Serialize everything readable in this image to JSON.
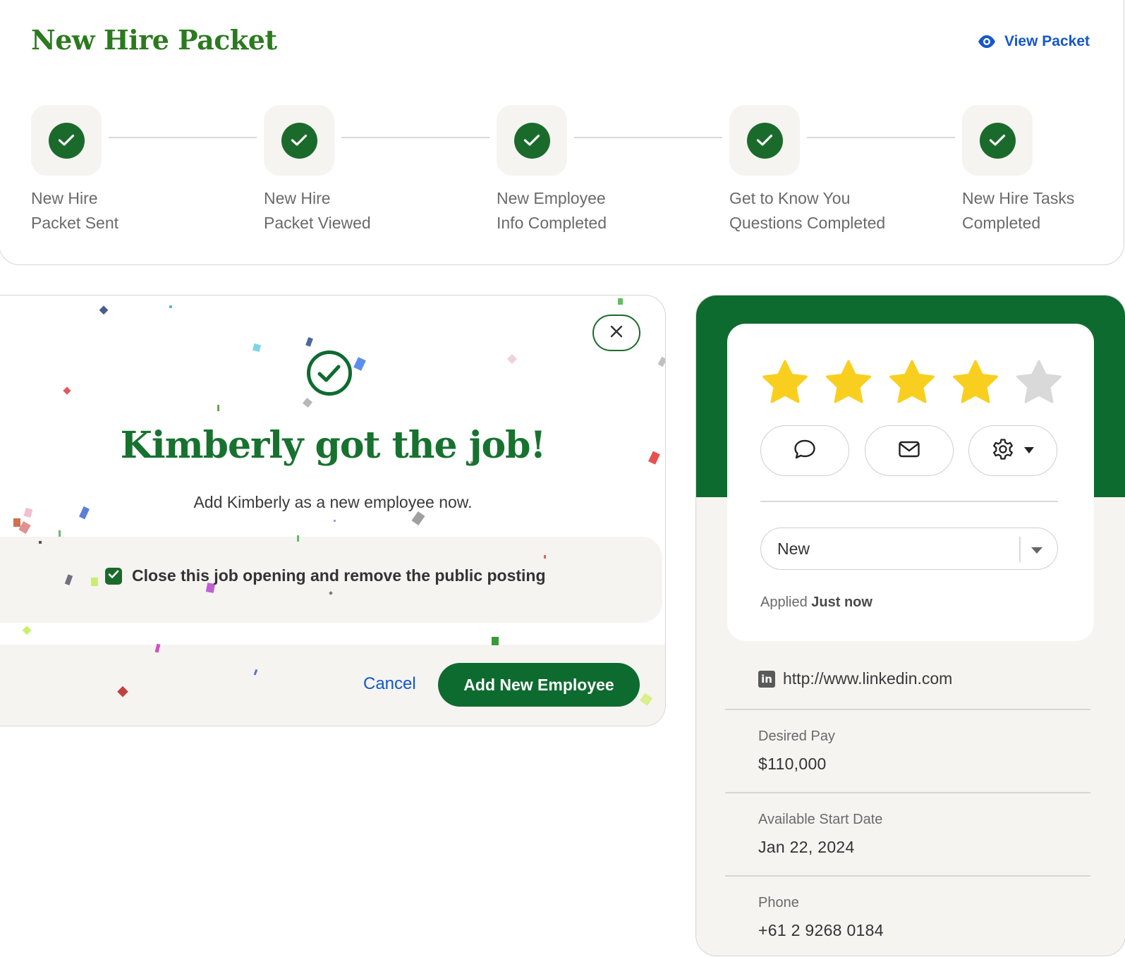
{
  "packet": {
    "title": "New Hire Packet",
    "view_link": "View Packet",
    "steps": [
      {
        "line1": "New Hire",
        "line2": "Packet Sent",
        "status": "complete"
      },
      {
        "line1": "New Hire",
        "line2": "Packet Viewed",
        "status": "complete"
      },
      {
        "line1": "New Employee",
        "line2": "Info Completed",
        "status": "complete"
      },
      {
        "line1": "Get to Know You",
        "line2": "Questions Completed",
        "status": "complete"
      },
      {
        "line1": "New Hire Tasks",
        "line2": "Completed",
        "status": "complete"
      }
    ]
  },
  "modal": {
    "title": "Kimberly got the job!",
    "subtitle": "Add Kimberly as a new employee now.",
    "checkbox_label": "Close this job opening and remove the public posting",
    "checkbox_checked": true,
    "cancel_label": "Cancel",
    "primary_label": "Add New Employee"
  },
  "candidate": {
    "rating": 4,
    "rating_max": 5,
    "actions": [
      {
        "icon": "chat-bubble-icon"
      },
      {
        "icon": "mail-icon"
      },
      {
        "icon": "gear-icon",
        "has_dropdown": true
      }
    ],
    "status_value": "New",
    "applied_prefix": "Applied",
    "applied_time": "Just now",
    "linkedin_url": "http://www.linkedin.com",
    "desired_pay_label": "Desired Pay",
    "desired_pay_value": "$110,000",
    "start_date_label": "Available Start Date",
    "start_date_value": "Jan 22, 2024",
    "phone_label": "Phone",
    "phone_value": "+61 2 9268 0184"
  },
  "colors": {
    "brand_green": "#0e6b2f",
    "title_green": "#2c7a1f",
    "link_blue": "#1557c9",
    "star_yellow": "#f9cf1f",
    "star_empty": "#d9d9d9"
  }
}
